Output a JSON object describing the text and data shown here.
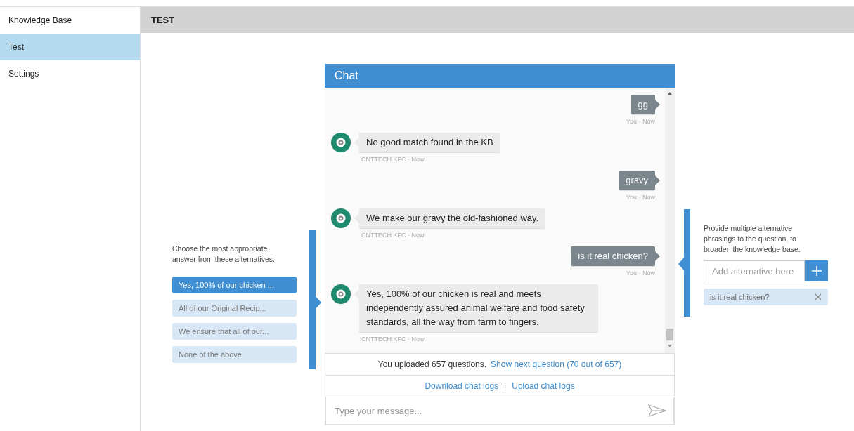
{
  "sidebar": {
    "items": [
      {
        "label": "Knowledge Base",
        "selected": false
      },
      {
        "label": "Test",
        "selected": true
      },
      {
        "label": "Settings",
        "selected": false
      }
    ]
  },
  "header": {
    "title": "TEST"
  },
  "chat": {
    "title": "Chat",
    "messages": [
      {
        "kind": "user",
        "text": "gg",
        "meta": "You · Now"
      },
      {
        "kind": "bot",
        "text": "No good match found in the KB",
        "meta": "CNTTECH KFC · Now"
      },
      {
        "kind": "user",
        "text": "gravy",
        "meta": "You · Now"
      },
      {
        "kind": "bot",
        "text": "We make our gravy the old-fashioned way.",
        "meta": "CNTTECH KFC · Now"
      },
      {
        "kind": "user",
        "text": "is it real chicken?",
        "meta": "You · Now"
      },
      {
        "kind": "bot",
        "text": "Yes, 100% of our chicken is real and meets independently assured animal welfare and food safety standards, all the way from farm to fingers.",
        "meta": "CNTTECH KFC · Now"
      }
    ],
    "upload_status": "You uploaded 657 questions.",
    "next_question_link": "Show next question (70 out of 657)",
    "download_link": "Download chat logs",
    "separator": "|",
    "upload_link": "Upload chat logs",
    "input": {
      "placeholder": "Type your message..."
    }
  },
  "answers_panel": {
    "instruction": "Choose the most appropriate answer from these alternatives.",
    "options": [
      {
        "label": "Yes, 100% of our chicken ...",
        "selected": true
      },
      {
        "label": "All of our Original Recip...",
        "selected": false
      },
      {
        "label": "We ensure that all of our...",
        "selected": false
      },
      {
        "label": "None of the above",
        "selected": false
      }
    ]
  },
  "alternatives_panel": {
    "instruction": "Provide multiple alternative phrasings to the question, to broaden the knowledge base.",
    "input": {
      "placeholder": "Add alternative here"
    },
    "alternatives": [
      {
        "text": "is it real chicken?"
      }
    ]
  }
}
